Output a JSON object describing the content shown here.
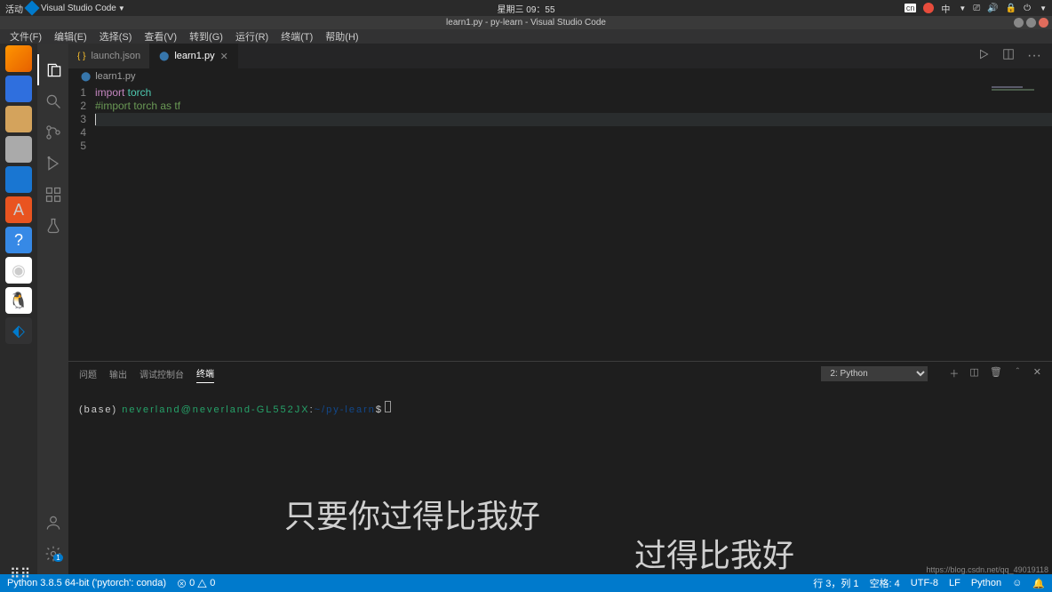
{
  "gnome": {
    "activities": "活动",
    "app_name": "Visual Studio Code",
    "datetime": "星期三 09：55",
    "kbd": "cn",
    "ime": "中"
  },
  "window": {
    "title": "learn1.py - py-learn - Visual Studio Code"
  },
  "menu": {
    "file": "文件(F)",
    "edit": "编辑(E)",
    "select": "选择(S)",
    "view": "查看(V)",
    "go": "转到(G)",
    "run": "运行(R)",
    "terminal": "终端(T)",
    "help": "帮助(H)"
  },
  "tabs": {
    "t1": "launch.json",
    "t2": "learn1.py"
  },
  "breadcrumb": {
    "file": "learn1.py"
  },
  "code": {
    "l1_kw": "import",
    "l1_mod": " torch",
    "l2": "#import torch as tf",
    "lines": [
      "1",
      "2",
      "3",
      "4",
      "5"
    ]
  },
  "panel": {
    "problems": "问题",
    "output": "输出",
    "debug": "调试控制台",
    "terminal": "终端",
    "select": "2: Python"
  },
  "terminal": {
    "base": "(base) ",
    "user": "neverland@neverland-GL552JX",
    "colon": ":",
    "path": "~/py-learn",
    "prompt": "$"
  },
  "overlay": {
    "text1": "只要你过得比我好",
    "text2": "过得比我好"
  },
  "status": {
    "python": "Python 3.8.5 64-bit ('pytorch': conda)",
    "errors": "0",
    "warnings": "0",
    "ln_col": "行 3，列 1",
    "spaces": "空格: 4",
    "encoding": "UTF-8",
    "eol": "LF",
    "lang": "Python"
  },
  "activity": {
    "settings_badge": "1"
  },
  "watermark": "https://blog.csdn.net/qq_49019118"
}
